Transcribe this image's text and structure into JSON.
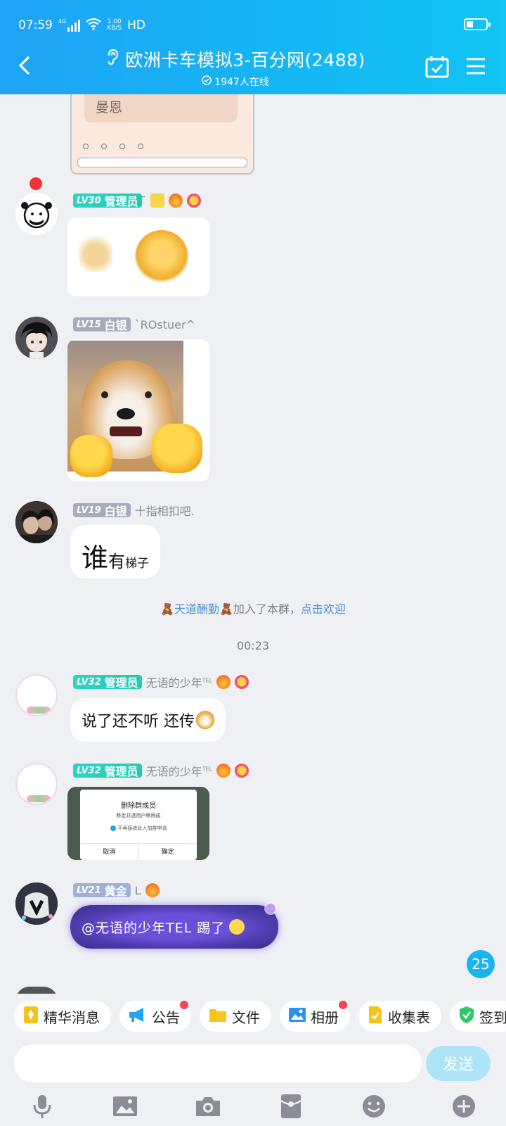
{
  "status": {
    "time": "07:59",
    "net_type": "4G",
    "speed": "1.00",
    "speed_unit": "KB/S",
    "hd": "HD",
    "battery_level": 0.35
  },
  "header": {
    "title": "欧洲卡车模拟3-百分网(2488)",
    "online": "1947人在线"
  },
  "messages": {
    "top_card_text": "曼恩",
    "m1": {
      "lv": "LV30",
      "role": "管理员",
      "name": "̃̃"
    },
    "m2": {
      "lv": "LV15",
      "role": "白银",
      "name": "`ROstuer^"
    },
    "m3": {
      "lv": "LV19",
      "role": "白银",
      "name": "十指相扣吧.",
      "text_big": "谁",
      "text_mid": "有",
      "text_small": "梯子"
    },
    "join": {
      "name": "天道酬勤",
      "text": "加入了本群，",
      "link": "点击欢迎"
    },
    "time": "00:23",
    "m4": {
      "lv": "LV32",
      "role": "管理员",
      "name": "无语的少年",
      "name_sup": "TEL",
      "text": "说了还不听 还传"
    },
    "m5": {
      "lv": "LV32",
      "role": "管理员",
      "name": "无语的少年",
      "name_sup": "TEL",
      "dialog": {
        "title": "删除群成员",
        "body": "移走并选用户移除成",
        "check": "不再接收此人加群申请",
        "cancel": "取消",
        "ok": "确定"
      }
    },
    "m6": {
      "lv": "LV21",
      "role": "黄金",
      "name": "L",
      "text": "@无语的少年TEL 踢了"
    }
  },
  "unread_count": "25",
  "quickbar": [
    {
      "label": "精华消息",
      "icon": "essence-icon",
      "dot": false
    },
    {
      "label": "公告",
      "icon": "announcement-icon",
      "dot": true
    },
    {
      "label": "文件",
      "icon": "folder-icon",
      "dot": false
    },
    {
      "label": "相册",
      "icon": "album-icon",
      "dot": true
    },
    {
      "label": "收集表",
      "icon": "form-icon",
      "dot": false
    },
    {
      "label": "签到",
      "icon": "checkin-icon",
      "dot": false
    }
  ],
  "input": {
    "placeholder": "",
    "send_label": "发送"
  },
  "actions": [
    "mic-icon",
    "image-icon",
    "camera-icon",
    "red-packet-icon",
    "emoji-icon",
    "plus-icon"
  ]
}
